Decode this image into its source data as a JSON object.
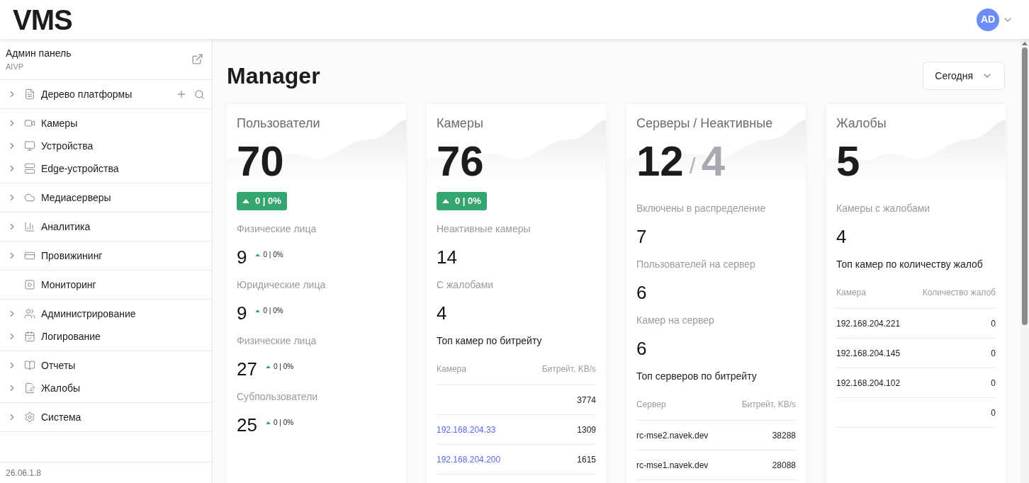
{
  "header": {
    "logo": "VMS",
    "avatar": "AD"
  },
  "sidebar": {
    "title": "Админ панель",
    "subtitle": "AIVP",
    "groups": [
      [
        {
          "label": "Дерево платформы",
          "expandable": true,
          "actions": true
        }
      ],
      [
        {
          "label": "Камеры",
          "expandable": true,
          "actions": false
        },
        {
          "label": "Устройства",
          "expandable": true,
          "actions": false
        },
        {
          "label": "Edge-устройства",
          "expandable": true,
          "actions": false
        }
      ],
      [
        {
          "label": "Медиасерверы",
          "expandable": true,
          "actions": false
        }
      ],
      [
        {
          "label": "Аналитика",
          "expandable": true,
          "actions": false
        }
      ],
      [
        {
          "label": "Провижининг",
          "expandable": true,
          "actions": false
        }
      ],
      [
        {
          "label": "Мониторинг",
          "expandable": false,
          "actions": false
        }
      ],
      [
        {
          "label": "Администрирование",
          "expandable": true,
          "actions": false
        },
        {
          "label": "Логирование",
          "expandable": true,
          "actions": false
        }
      ],
      [
        {
          "label": "Отчеты",
          "expandable": true,
          "actions": false
        },
        {
          "label": "Жалобы",
          "expandable": true,
          "actions": false
        }
      ],
      [
        {
          "label": "Система",
          "expandable": true,
          "actions": false
        }
      ]
    ],
    "version": "26.06.1.8"
  },
  "page": {
    "title": "Manager",
    "period": "Сегодня"
  },
  "cards": [
    {
      "title": "Пользователи",
      "total": "70",
      "change": "0 | 0%",
      "metrics": [
        {
          "label": "Физические лица",
          "value": "9",
          "change": "0 | 0%"
        },
        {
          "label": "Юридические лица",
          "value": "9",
          "change": "0 | 0%"
        },
        {
          "label": "Физические лица",
          "value": "27",
          "change": "0 | 0%"
        },
        {
          "label": "Субпользователи",
          "value": "25",
          "change": "0 | 0%"
        }
      ]
    },
    {
      "title": "Камеры",
      "total": "76",
      "change": "0 | 0%",
      "metrics": [
        {
          "label": "Неактивные камеры",
          "value": "14"
        },
        {
          "label": "С жалобами",
          "value": "4"
        }
      ],
      "table": {
        "title": "Топ камер по битрейту",
        "columns": [
          "Камера",
          "Битрейт, KB/s"
        ],
        "rows": [
          {
            "value": "3774"
          },
          {
            "name": "192.168.204.33",
            "value": "1309",
            "link": true
          },
          {
            "name": "192.168.204.200",
            "value": "1615",
            "link": true
          }
        ]
      }
    },
    {
      "title": "Серверы / Неактивные",
      "total": "12",
      "separator": "/",
      "total_secondary": "4",
      "metrics": [
        {
          "label": "Включены в распределение",
          "value": "7"
        },
        {
          "label": "Пользователей на сервер",
          "value": "6"
        },
        {
          "label": "Камер на сервер",
          "value": "6"
        }
      ],
      "table": {
        "title": "Топ серверов по битрейту",
        "columns": [
          "Сервер",
          "Битрейт, KB/s"
        ],
        "rows": [
          {
            "name": "rc-mse2.navek.dev",
            "value": "38288",
            "link": false
          },
          {
            "name": "rc-mse1.navek.dev",
            "value": "28088",
            "link": false
          }
        ]
      }
    },
    {
      "title": "Жалобы",
      "total": "5",
      "metrics": [
        {
          "label": "Камеры с жалобами",
          "value": "4"
        }
      ],
      "table": {
        "title": "Топ камер по количеству жалоб",
        "columns": [
          "Камера",
          "Количество жалоб"
        ],
        "rows": [
          {
            "name": "192.168.204.221",
            "value": "0",
            "link": false
          },
          {
            "name": "192.168.204.145",
            "value": "0",
            "link": false
          },
          {
            "name": "192.168.204.102",
            "value": "0",
            "link": false
          },
          {
            "value": "0"
          }
        ]
      }
    }
  ]
}
